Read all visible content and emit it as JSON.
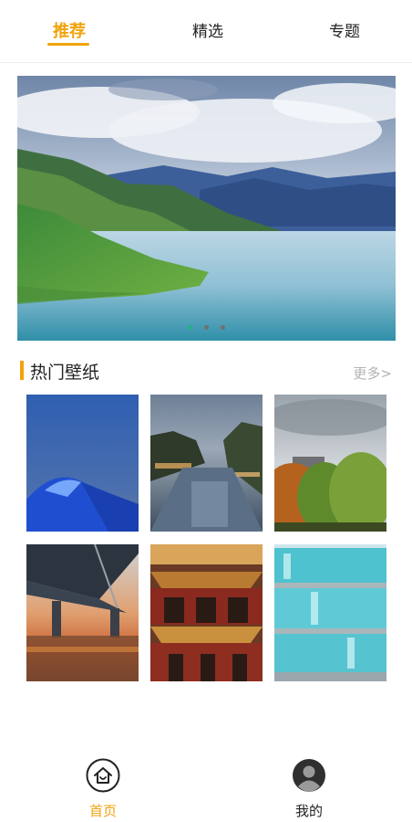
{
  "top_tabs": [
    {
      "label": "推荐",
      "active": true
    },
    {
      "label": "精选",
      "active": false
    },
    {
      "label": "专题",
      "active": false
    }
  ],
  "banner": {
    "slide_count": 3,
    "active_index": 0
  },
  "section": {
    "title": "热门壁纸",
    "more_label": "更多>"
  },
  "wallpapers": [
    {
      "name": "blue-tent-under-evening-sky"
    },
    {
      "name": "canal-town-at-dusk"
    },
    {
      "name": "autumn-trees-and-cloudy-sky"
    },
    {
      "name": "bridge-at-sunset"
    },
    {
      "name": "illuminated-palace-gate"
    },
    {
      "name": "glowing-blue-building-facade"
    }
  ],
  "bottom_nav": [
    {
      "label": "首页",
      "icon": "home-icon",
      "active": true
    },
    {
      "label": "我的",
      "icon": "profile-icon",
      "active": false
    }
  ],
  "colors": {
    "accent": "#f0a30a",
    "dot_active": "#26b08a",
    "dot_inactive": "#6f6f6f",
    "more_gray": "#b3b3b3"
  }
}
